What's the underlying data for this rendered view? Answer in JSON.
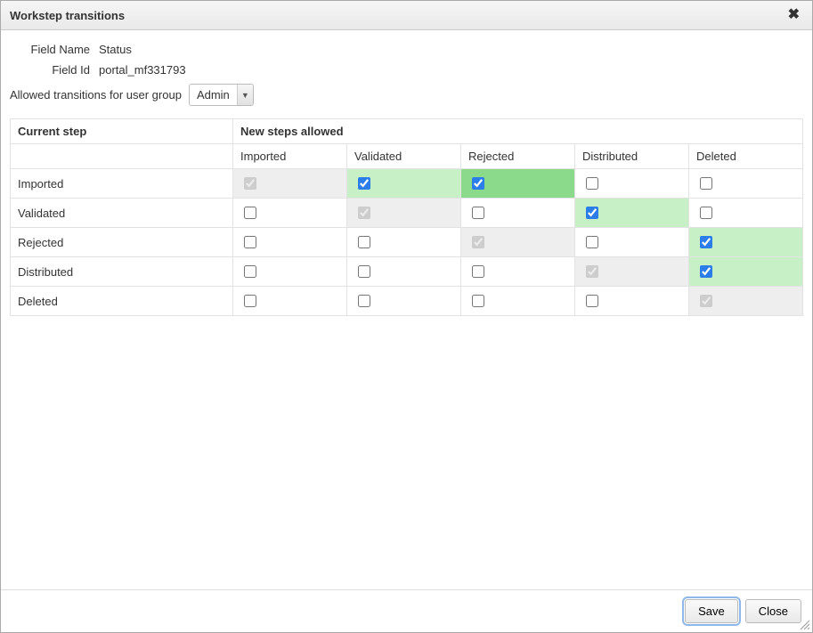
{
  "dialog": {
    "title": "Workstep transitions",
    "close_icon": "✕"
  },
  "meta": {
    "field_name_label": "Field Name",
    "field_name_value": "Status",
    "field_id_label": "Field Id",
    "field_id_value": "portal_mf331793"
  },
  "group": {
    "label": "Allowed transitions for user group",
    "selected": "Admin"
  },
  "table": {
    "header_current": "Current step",
    "header_new": "New steps allowed",
    "steps": [
      "Imported",
      "Validated",
      "Rejected",
      "Distributed",
      "Deleted"
    ],
    "matrix": [
      {
        "row": "Imported",
        "cells": [
          {
            "checked": true,
            "self": true
          },
          {
            "checked": true,
            "bg": "green-light"
          },
          {
            "checked": true,
            "bg": "green-dark"
          },
          {
            "checked": false,
            "bg": "white"
          },
          {
            "checked": false,
            "bg": "white"
          }
        ]
      },
      {
        "row": "Validated",
        "cells": [
          {
            "checked": false,
            "bg": "white"
          },
          {
            "checked": true,
            "self": true
          },
          {
            "checked": false,
            "bg": "white"
          },
          {
            "checked": true,
            "bg": "green-light"
          },
          {
            "checked": false,
            "bg": "white"
          }
        ]
      },
      {
        "row": "Rejected",
        "cells": [
          {
            "checked": false,
            "bg": "white"
          },
          {
            "checked": false,
            "bg": "white"
          },
          {
            "checked": true,
            "self": true
          },
          {
            "checked": false,
            "bg": "white"
          },
          {
            "checked": true,
            "bg": "green-light"
          }
        ]
      },
      {
        "row": "Distributed",
        "cells": [
          {
            "checked": false,
            "bg": "white"
          },
          {
            "checked": false,
            "bg": "white"
          },
          {
            "checked": false,
            "bg": "white"
          },
          {
            "checked": true,
            "self": true
          },
          {
            "checked": true,
            "bg": "green-light"
          }
        ]
      },
      {
        "row": "Deleted",
        "cells": [
          {
            "checked": false,
            "bg": "white"
          },
          {
            "checked": false,
            "bg": "white"
          },
          {
            "checked": false,
            "bg": "white"
          },
          {
            "checked": false,
            "bg": "white"
          },
          {
            "checked": true,
            "self": true
          }
        ]
      }
    ]
  },
  "footer": {
    "save_label": "Save",
    "close_label": "Close"
  }
}
